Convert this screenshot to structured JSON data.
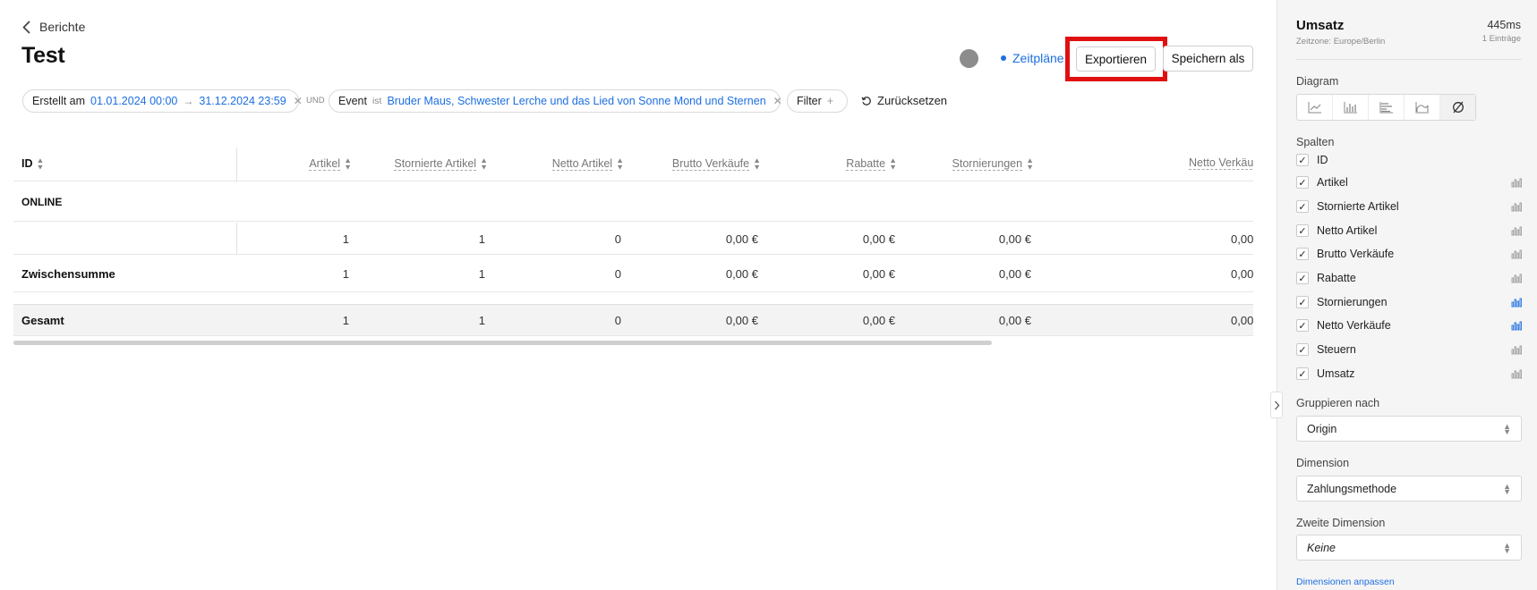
{
  "breadcrumb": {
    "back_label": "Berichte"
  },
  "page": {
    "title": "Test"
  },
  "toolbar": {
    "schedules_label": "Zeitpläne",
    "export_label": "Exportieren",
    "save_as_label": "Speichern als"
  },
  "filters": {
    "created": {
      "label": "Erstellt am",
      "from": "01.01.2024 00:00",
      "arrow": "→",
      "to": "31.12.2024 23:59"
    },
    "joiner": "UND",
    "event": {
      "label": "Event",
      "operator": "ist",
      "value": "Bruder Maus, Schwester Lerche und das Lied von Sonne Mond und Sternen"
    },
    "filter_label": "Filter",
    "reset_label": "Zurücksetzen"
  },
  "table": {
    "id_header": "ID",
    "columns": [
      "Artikel",
      "Stornierte Artikel",
      "Netto Artikel",
      "Brutto Verkäufe",
      "Rabatte",
      "Stornierungen",
      "Netto Verkäuf"
    ],
    "group_label": "ONLINE",
    "group_row": [
      "1",
      "1",
      "0",
      "0,00 €",
      "0,00 €",
      "0,00 €",
      "0,00"
    ],
    "subtotal": {
      "label": "Zwischensumme",
      "values": [
        "1",
        "1",
        "0",
        "0,00 €",
        "0,00 €",
        "0,00 €",
        "0,00"
      ]
    },
    "total": {
      "label": "Gesamt",
      "values": [
        "1",
        "1",
        "0",
        "0,00 €",
        "0,00 €",
        "0,00 €",
        "0,00"
      ]
    }
  },
  "sidebar": {
    "title": "Umsatz",
    "duration": "445ms",
    "timezone": "Zeitzone: Europe/Berlin",
    "entries": "1 Einträge",
    "diagram_label": "Diagram",
    "diagram_types": [
      "line-chart-icon",
      "bar-chart-icon",
      "horizontal-bar-icon",
      "area-chart-icon",
      "none-icon"
    ],
    "columns_label": "Spalten",
    "columns": [
      {
        "label": "ID",
        "checked": true,
        "chart": ""
      },
      {
        "label": "Artikel",
        "checked": true,
        "chart": "inactive"
      },
      {
        "label": "Stornierte Artikel",
        "checked": true,
        "chart": "inactive"
      },
      {
        "label": "Netto Artikel",
        "checked": true,
        "chart": "inactive"
      },
      {
        "label": "Brutto Verkäufe",
        "checked": true,
        "chart": "inactive"
      },
      {
        "label": "Rabatte",
        "checked": true,
        "chart": "inactive"
      },
      {
        "label": "Stornierungen",
        "checked": true,
        "chart": "active"
      },
      {
        "label": "Netto Verkäufe",
        "checked": true,
        "chart": "active"
      },
      {
        "label": "Steuern",
        "checked": true,
        "chart": "inactive"
      },
      {
        "label": "Umsatz",
        "checked": true,
        "chart": "inactive"
      }
    ],
    "group_by_label": "Gruppieren nach",
    "group_by_value": "Origin",
    "dimension_label": "Dimension",
    "dimension_value": "Zahlungsmethode",
    "second_dimension_label": "Zweite Dimension",
    "second_dimension_value": "Keine",
    "customize_link": "Dimensionen anpassen"
  },
  "colors": {
    "accent": "#1d6fe0",
    "highlight": "#e11010",
    "status_dot": "#8c8c8c",
    "chart_inactive": "#9a9a9a"
  }
}
